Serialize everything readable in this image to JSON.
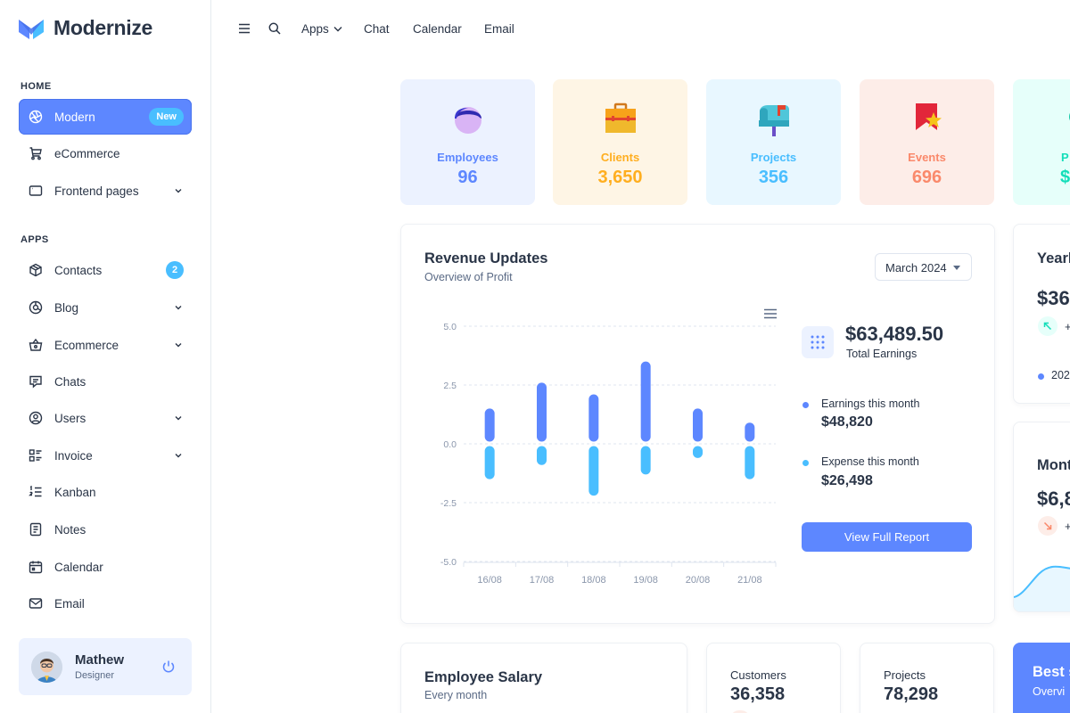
{
  "brand": {
    "name": "Modernize"
  },
  "sidebar": {
    "sections": [
      {
        "caption": "HOME"
      },
      {
        "caption": "APPS"
      }
    ],
    "items": [
      {
        "label": "Modern",
        "badge": "New",
        "icon": "aperture-icon"
      },
      {
        "label": "eCommerce",
        "icon": "cart-icon"
      },
      {
        "label": "Frontend pages",
        "icon": "app-window-icon"
      },
      {
        "label": "Contacts",
        "badge": "2",
        "icon": "package-icon"
      },
      {
        "label": "Blog",
        "icon": "chart-donut-icon"
      },
      {
        "label": "Ecommerce",
        "icon": "basket-icon"
      },
      {
        "label": "Chats",
        "icon": "message-icon"
      },
      {
        "label": "Users",
        "icon": "user-circle-icon"
      },
      {
        "label": "Invoice",
        "icon": "file-list-icon"
      },
      {
        "label": "Kanban",
        "icon": "list-numbers-icon"
      },
      {
        "label": "Notes",
        "icon": "notes-icon"
      },
      {
        "label": "Calendar",
        "icon": "calendar-icon"
      },
      {
        "label": "Email",
        "icon": "mail-icon"
      }
    ],
    "profile": {
      "name": "Mathew",
      "role": "Designer"
    }
  },
  "topbar": {
    "links": [
      "Apps",
      "Chat",
      "Calendar",
      "Email"
    ]
  },
  "stats": [
    {
      "label": "Employees",
      "value": "96",
      "color": "#5d87ff",
      "bg": "#ecf2ff"
    },
    {
      "label": "Clients",
      "value": "3,650",
      "color": "#ffae1f",
      "bg": "#fef5e5"
    },
    {
      "label": "Projects",
      "value": "356",
      "color": "#49beff",
      "bg": "#e8f7ff"
    },
    {
      "label": "Events",
      "value": "696",
      "color": "#fa896b",
      "bg": "#fdede8"
    },
    {
      "label": "P",
      "value": "$",
      "color": "#13deb9",
      "bg": "#e6fffa"
    }
  ],
  "revenue": {
    "title": "Revenue Updates",
    "subtitle": "Overview of Profit",
    "month": "March 2024",
    "total": "$63,489.50",
    "total_label": "Total Earnings",
    "earnings_label": "Earnings this month",
    "earnings_value": "$48,820",
    "expense_label": "Expense this month",
    "expense_value": "$26,498",
    "button": "View Full Report"
  },
  "chart_data": {
    "type": "bar",
    "categories": [
      "16/08",
      "17/08",
      "18/08",
      "19/08",
      "20/08",
      "21/08"
    ],
    "series": [
      {
        "name": "Earnings this month",
        "values": [
          1.5,
          2.6,
          2.1,
          3.5,
          1.5,
          0.9
        ],
        "color": "#5d87ff"
      },
      {
        "name": "Expense this month",
        "values": [
          -1.5,
          -0.9,
          -2.2,
          -1.3,
          -0.6,
          -1.5
        ],
        "color": "#49beff"
      }
    ],
    "yticks": [
      "5.0",
      "2.5",
      "0.0",
      "-2.5",
      "-5.0"
    ],
    "ylim": [
      -5,
      5
    ],
    "grid": true
  },
  "right_cards": {
    "yearly_title": "Yearl",
    "yearly_value": "$36",
    "yearly_delta": "+",
    "yearly_legend": "202",
    "monthly_title": "Mont",
    "monthly_value": "$6,8",
    "monthly_delta": "+"
  },
  "bottom": {
    "salary_title": "Employee Salary",
    "salary_sub": "Every month",
    "customers_label": "Customers",
    "customers_value": "36,358",
    "projects_label": "Projects",
    "projects_value": "78,298",
    "best_title": "Best s",
    "best_sub": "Overvi"
  }
}
